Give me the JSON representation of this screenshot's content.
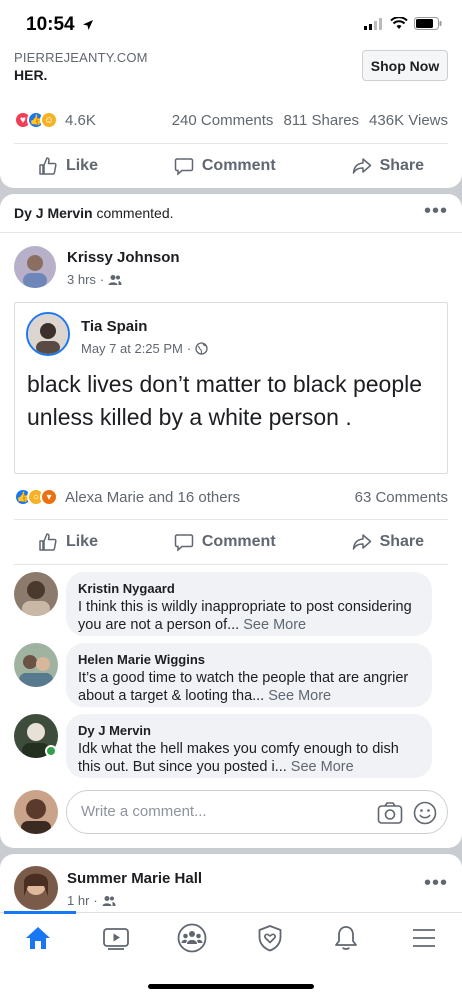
{
  "status_bar": {
    "time": "10:54"
  },
  "ad": {
    "domain": "PIERREJEANTY.COM",
    "headline": "HER.",
    "cta_label": "Shop Now",
    "reaction_count": "4.6K",
    "comments": "240 Comments",
    "shares": "811 Shares",
    "views": "436K Views"
  },
  "actions": {
    "like": "Like",
    "comment": "Comment",
    "share": "Share"
  },
  "post": {
    "context_name": "Dy J Mervin",
    "context_verb": "commented.",
    "author": "Krissy Johnson",
    "time": "3 hrs",
    "shared": {
      "name": "Tia Spain",
      "time": "May 7 at 2:25 PM",
      "text": "black lives don’t matter to black people unless killed by a white person ."
    },
    "reactions_text": "Alexa Marie and 16 others",
    "comments_count": "63 Comments",
    "comments": [
      {
        "name": "Kristin Nygaard",
        "text": "I think this is wildly inappropriate to post considering you are not a person of...",
        "see_more": "See More"
      },
      {
        "name": "Helen Marie Wiggins",
        "text": "It’s a good time to watch the people that are angrier about a target & looting tha...",
        "see_more": "See More"
      },
      {
        "name": "Dy J Mervin",
        "text": "Idk what the hell makes you comfy enough to dish this out. But since you posted i...",
        "see_more": "See More"
      }
    ],
    "write_placeholder": "Write a comment..."
  },
  "next_post": {
    "author": "Summer Marie Hall",
    "time": "1 hr"
  },
  "colors": {
    "accent": "#1877f2",
    "background": "#c9ccd1"
  },
  "icons": [
    "home-icon",
    "watch-icon",
    "groups-icon",
    "shield-icon",
    "bell-icon",
    "menu-icon"
  ]
}
